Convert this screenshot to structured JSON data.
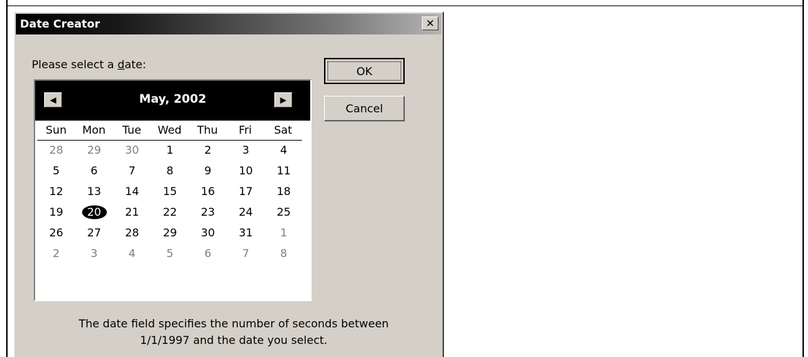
{
  "dialog": {
    "title": "Date Creator",
    "close_glyph": "✕",
    "prompt_before": "Please select a ",
    "prompt_accel": "d",
    "prompt_after": "ate:",
    "ok_label": "OK",
    "cancel_label": "Cancel",
    "footer_line1": "The date field specifies the  number of seconds between",
    "footer_line2": "1/1/1997 and the date you select."
  },
  "calendar": {
    "month_label": "May, 2002",
    "prev_glyph": "◀",
    "next_glyph": "▶",
    "weekdays": [
      "Sun",
      "Mon",
      "Tue",
      "Wed",
      "Thu",
      "Fri",
      "Sat"
    ],
    "weeks": [
      [
        {
          "d": "28",
          "m": true
        },
        {
          "d": "29",
          "m": true
        },
        {
          "d": "30",
          "m": true
        },
        {
          "d": "1"
        },
        {
          "d": "2"
        },
        {
          "d": "3"
        },
        {
          "d": "4"
        }
      ],
      [
        {
          "d": "5"
        },
        {
          "d": "6"
        },
        {
          "d": "7"
        },
        {
          "d": "8"
        },
        {
          "d": "9"
        },
        {
          "d": "10"
        },
        {
          "d": "11"
        }
      ],
      [
        {
          "d": "12"
        },
        {
          "d": "13"
        },
        {
          "d": "14"
        },
        {
          "d": "15"
        },
        {
          "d": "16"
        },
        {
          "d": "17"
        },
        {
          "d": "18"
        }
      ],
      [
        {
          "d": "19"
        },
        {
          "d": "20",
          "s": true
        },
        {
          "d": "21"
        },
        {
          "d": "22"
        },
        {
          "d": "23"
        },
        {
          "d": "24"
        },
        {
          "d": "25"
        }
      ],
      [
        {
          "d": "26"
        },
        {
          "d": "27"
        },
        {
          "d": "28"
        },
        {
          "d": "29"
        },
        {
          "d": "30"
        },
        {
          "d": "31"
        },
        {
          "d": "1",
          "m": true
        }
      ],
      [
        {
          "d": "2",
          "m": true
        },
        {
          "d": "3",
          "m": true
        },
        {
          "d": "4",
          "m": true
        },
        {
          "d": "5",
          "m": true
        },
        {
          "d": "6",
          "m": true
        },
        {
          "d": "7",
          "m": true
        },
        {
          "d": "8",
          "m": true
        }
      ]
    ]
  },
  "colors": {
    "dialog_bg": "#d4d0c8",
    "title_start": "#000000",
    "title_end": "#b5b5b5",
    "muted_day": "#808080"
  }
}
